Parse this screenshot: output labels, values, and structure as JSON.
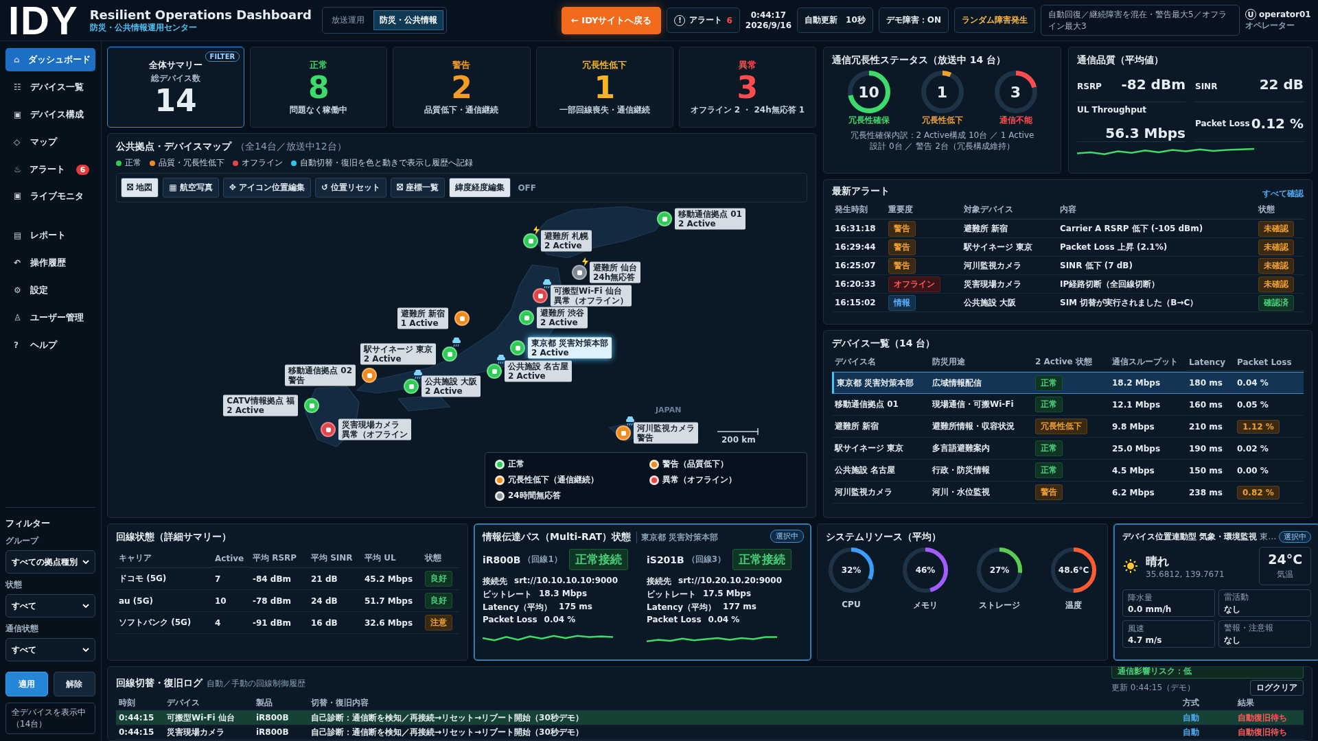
{
  "header": {
    "logo": "IDY",
    "title": "Resilient Operations Dashboard",
    "subtitle": "防災・公共情報運用センター",
    "modes": [
      {
        "label": "放送運用",
        "selected": false
      },
      {
        "label": "防災・公共情報",
        "selected": true
      }
    ],
    "back_button": "← IDYサイトへ戻る",
    "alert_button": {
      "icon": "!",
      "label": "アラート",
      "count": "6"
    },
    "time": "0:44:17",
    "date": "2026/9/16",
    "auto_refresh": "自動更新　10秒",
    "demo_fault": "デモ障害：ON",
    "random_fault": "ランダム障害発生",
    "notice": "自動回復／継続障害を混在・警告最大5／オフライン最大3",
    "user": {
      "icon": "U",
      "name": "operator01",
      "role": "オペレーター"
    }
  },
  "sidebar": {
    "items": [
      {
        "icon": "⌂",
        "label": "ダッシュボード",
        "selected": true
      },
      {
        "icon": "☷",
        "label": "デバイス一覧",
        "selected": false
      },
      {
        "icon": "▣",
        "label": "デバイス構成",
        "selected": false
      },
      {
        "icon": "◇",
        "label": "マップ",
        "selected": false
      },
      {
        "icon": "♨",
        "label": "アラート",
        "selected": false,
        "badge": "6"
      },
      {
        "icon": "▣",
        "label": "ライブモニタ",
        "selected": false
      },
      {
        "icon": "▤",
        "label": "レポート",
        "selected": false
      },
      {
        "icon": "↶",
        "label": "操作履歴",
        "selected": false
      },
      {
        "icon": "⚙",
        "label": "設定",
        "selected": false
      },
      {
        "icon": "♙",
        "label": "ユーザー管理",
        "selected": false
      },
      {
        "icon": "?",
        "label": "ヘルプ",
        "selected": false
      }
    ],
    "filters": {
      "title": "フィルター",
      "fields": [
        {
          "label": "グループ",
          "value": "すべての拠点種別"
        },
        {
          "label": "状態",
          "value": "すべて"
        },
        {
          "label": "通信状態",
          "value": "すべて"
        }
      ],
      "apply": "適用",
      "clear": "解除",
      "status": "全デバイスを表示中（14台）"
    }
  },
  "summary": {
    "cards": [
      {
        "kind": "total",
        "title": "全体サマリー",
        "subtitle": "総デバイス数",
        "value": "14",
        "badge": "FILTER"
      },
      {
        "kind": "status",
        "title": "正常",
        "value": "8",
        "note": "問題なく稼働中",
        "color": "#3ddc6a"
      },
      {
        "kind": "status",
        "title": "警告",
        "value": "2",
        "note": "品質低下・通信継続",
        "color": "#f59b23"
      },
      {
        "kind": "status",
        "title": "冗長性低下",
        "value": "1",
        "note": "一部回線喪失・通信継続",
        "color": "#f5b420"
      },
      {
        "kind": "status",
        "title": "異常",
        "value": "3",
        "note": "オフライン 2 ・ 24h無応答 1",
        "color": "#ff4d4f"
      }
    ]
  },
  "map": {
    "title": "公共拠点・デバイスマップ",
    "count": "（全14台／放送中12台）",
    "legend_line": [
      {
        "label": "正常",
        "color": "#2ecc55"
      },
      {
        "label": "品質・冗長性低下",
        "color": "#f08a1c"
      },
      {
        "label": "オフライン",
        "color": "#e84545"
      },
      {
        "label": "自動切替・復旧を色と動きで表示し履歴へ記録",
        "color": "#2cc6f0"
      }
    ],
    "tools": [
      {
        "icon": "⛝",
        "label": "地図",
        "selected": true
      },
      {
        "icon": "▦",
        "label": "航空写真",
        "selected": false
      },
      {
        "icon": "✥",
        "label": "アイコン位置編集",
        "selected": false
      },
      {
        "icon": "↺",
        "label": "位置リセット",
        "selected": false
      },
      {
        "icon": "⛝",
        "label": "座標一覧",
        "selected": false
      }
    ],
    "latlon_edit": {
      "label": "緯度経度編集",
      "state": "OFF"
    },
    "markers": [
      {
        "name": "移動通信拠点 01",
        "status": "2 Active",
        "kind": "normal",
        "selected": false
      },
      {
        "name": "避難所 札幌",
        "status": "2 Active",
        "kind": "normal",
        "selected": false,
        "weather": {
          "kind": "lightning"
        }
      },
      {
        "name": "避難所 仙台",
        "status": "24h無応答",
        "kind": "noresponse",
        "selected": false,
        "weather": {
          "kind": "lightning"
        }
      },
      {
        "name": "可搬型Wi-Fi 仙台",
        "status": "異常（オフライン）",
        "kind": "offline",
        "selected": false,
        "weather": {
          "kind": "rain"
        }
      },
      {
        "name": "避難所 新宿",
        "status": "1 Active",
        "kind": "warning",
        "selected": false
      },
      {
        "name": "避難所 渋谷",
        "status": "2 Active",
        "kind": "normal",
        "selected": false
      },
      {
        "name": "駅サイネージ 東京",
        "status": "2 Active",
        "kind": "normal",
        "selected": false,
        "weather": {
          "kind": "rain"
        }
      },
      {
        "name": "東京都 災害対策本部",
        "status": "2 Active",
        "kind": "normal",
        "selected": true
      },
      {
        "name": "移動通信拠点 02",
        "status": "警告",
        "kind": "warning",
        "selected": false
      },
      {
        "name": "公共施設 大阪",
        "status": "2 Active",
        "kind": "normal",
        "selected": false,
        "weather": {
          "kind": "rain"
        }
      },
      {
        "name": "公共施設 名古屋",
        "status": "2 Active",
        "kind": "normal",
        "selected": false,
        "weather": {
          "kind": "rain"
        }
      },
      {
        "name": "CATV情報拠点 福",
        "status": "2 Active",
        "kind": "normal",
        "selected": false
      },
      {
        "name": "災害現場カメラ",
        "status": "異常（オフライン",
        "kind": "offline",
        "selected": false
      },
      {
        "name": "河川監視カメラ",
        "status": "警告",
        "kind": "warning",
        "selected": false,
        "weather": {
          "kind": "rain"
        }
      }
    ],
    "region_label": "JAPAN",
    "scale": "200 km",
    "legend": [
      {
        "label": "正常",
        "color": "#2ecc55"
      },
      {
        "label": "警告（品質低下）",
        "color": "#f08a1c"
      },
      {
        "label": "冗長性低下（通信継続）",
        "color": "#f08a1c"
      },
      {
        "label": "異常（オフライン）",
        "color": "#e84545"
      },
      {
        "label": "24時間無応答",
        "color": "#8a95a0"
      }
    ]
  },
  "redundancy": {
    "title": "通信冗長性ステータス（放送中 14 台）",
    "gauges": [
      {
        "value": "10",
        "label": "冗長性確保",
        "level": 0.72,
        "color": "#3ddc6a"
      },
      {
        "value": "1",
        "label": "冗長性低下",
        "level": 0.07,
        "color": "#f0a030"
      },
      {
        "value": "3",
        "label": "通信不能",
        "level": 0.21,
        "color": "#ff4d4f"
      }
    ],
    "note": "冗長性確保内訳：2 Active構成 10台 ／ 1 Active設計 0台 ／ 警告 2台（冗長構成維持）"
  },
  "quality": {
    "title": "通信品質（平均値）",
    "metrics": [
      {
        "label": "RSRP",
        "value": "-82 dBm"
      },
      {
        "label": "SINR",
        "value": "22 dB"
      },
      {
        "label": "UL Throughput",
        "value": "56.3 Mbps"
      },
      {
        "label": "Packet Loss",
        "value": "0.12 %"
      }
    ]
  },
  "alerts": {
    "title": "最新アラート",
    "link": "すべて確認",
    "columns": [
      "発生時刻",
      "重要度",
      "対象デバイス",
      "内容",
      "状態"
    ],
    "rows": [
      {
        "time": "16:31:18",
        "severity": {
          "label": "警告",
          "kind": "warning"
        },
        "device": "避難所 新宿",
        "content": "Carrier A RSRP 低下 (-105 dBm)",
        "status": {
          "label": "未確認",
          "kind": "open"
        }
      },
      {
        "time": "16:29:44",
        "severity": {
          "label": "警告",
          "kind": "warning"
        },
        "device": "駅サイネージ 東京",
        "content": "Packet Loss 上昇 (2.1%)",
        "status": {
          "label": "未確認",
          "kind": "open"
        }
      },
      {
        "time": "16:25:07",
        "severity": {
          "label": "警告",
          "kind": "warning"
        },
        "device": "河川監視カメラ",
        "content": "SINR 低下 (7 dB)",
        "status": {
          "label": "未確認",
          "kind": "open"
        }
      },
      {
        "time": "16:20:33",
        "severity": {
          "label": "オフライン",
          "kind": "offline"
        },
        "device": "災害現場カメラ",
        "content": "IP経路切断（全回線切断）",
        "status": {
          "label": "未確認",
          "kind": "open"
        }
      },
      {
        "time": "16:15:02",
        "severity": {
          "label": "情報",
          "kind": "info"
        },
        "device": "公共施設 大阪",
        "content": "SIM 切替が実行されました（B→C）",
        "status": {
          "label": "確認済",
          "kind": "done"
        }
      }
    ]
  },
  "devices": {
    "title": "デバイス一覧（14 台）",
    "columns": [
      "デバイス名",
      "防災用途",
      "2 Active 状態",
      "通信スループット",
      "Latency",
      "Packet Loss"
    ],
    "rows": [
      {
        "name": "東京都 災害対策本部",
        "use": "広域情報配信",
        "state": {
          "label": "正常",
          "kind": "normal"
        },
        "throughput": "18.2 Mbps",
        "latency": "180 ms",
        "loss": {
          "label": "0.04 %",
          "kind": "normal"
        },
        "selected": true
      },
      {
        "name": "移動通信拠点 01",
        "use": "現場通信・可搬Wi-Fi",
        "state": {
          "label": "正常",
          "kind": "normal"
        },
        "throughput": "12.1 Mbps",
        "latency": "160 ms",
        "loss": {
          "label": "0.05 %",
          "kind": "normal"
        },
        "selected": false
      },
      {
        "name": "避難所 新宿",
        "use": "避難所情報・収容状況",
        "state": {
          "label": "冗長性低下",
          "kind": "warning"
        },
        "throughput": "9.8 Mbps",
        "latency": "210 ms",
        "loss": {
          "label": "1.12 %",
          "kind": "warning"
        },
        "selected": false
      },
      {
        "name": "駅サイネージ 東京",
        "use": "多言語避難案内",
        "state": {
          "label": "正常",
          "kind": "normal"
        },
        "throughput": "25.0 Mbps",
        "latency": "190 ms",
        "loss": {
          "label": "0.02 %",
          "kind": "normal"
        },
        "selected": false
      },
      {
        "name": "公共施設 名古屋",
        "use": "行政・防災情報",
        "state": {
          "label": "正常",
          "kind": "normal"
        },
        "throughput": "4.5 Mbps",
        "latency": "150 ms",
        "loss": {
          "label": "0.00 %",
          "kind": "normal"
        },
        "selected": false
      },
      {
        "name": "河川監視カメラ",
        "use": "河川・水位監視",
        "state": {
          "label": "警告",
          "kind": "warning"
        },
        "throughput": "6.2 Mbps",
        "latency": "238 ms",
        "loss": {
          "label": "0.82 %",
          "kind": "warning"
        },
        "selected": false
      }
    ]
  },
  "lines": {
    "title": "回線状態（詳細サマリー）",
    "columns": [
      "キャリア",
      "Active",
      "平均 RSRP",
      "平均 SINR",
      "平均 UL",
      "状態"
    ],
    "rows": [
      {
        "carrier": "ドコモ (5G)",
        "active": "7",
        "rsrp": "-84 dBm",
        "sinr": "21 dB",
        "ul": "45.2 Mbps",
        "status": {
          "label": "良好",
          "kind": "good"
        }
      },
      {
        "carrier": "au (5G)",
        "active": "10",
        "rsrp": "-78 dBm",
        "sinr": "24 dB",
        "ul": "51.7 Mbps",
        "status": {
          "label": "良好",
          "kind": "good"
        }
      },
      {
        "carrier": "ソフトバンク (5G)",
        "active": "4",
        "rsrp": "-91 dBm",
        "sinr": "16 dB",
        "ul": "32.6 Mbps",
        "status": {
          "label": "注意",
          "kind": "caution"
        }
      }
    ]
  },
  "multirat": {
    "title": "情報伝達パス（Multi-RAT）状態",
    "subtitle": "東京都 災害対策本部",
    "badge": "選択中",
    "paths": [
      {
        "name": "iR800B",
        "line": "（回線1）",
        "status": "正常接続",
        "fields": [
          {
            "label": "接続先",
            "value": "srt://10.10.10.10:9000"
          },
          {
            "label": "ビットレート",
            "value": "18.3 Mbps"
          },
          {
            "label": "Latency（平均）",
            "value": "175 ms"
          },
          {
            "label": "Packet Loss",
            "value": "0.04 %"
          }
        ]
      },
      {
        "name": "iS201B",
        "line": "（回線3）",
        "status": "正常接続",
        "fields": [
          {
            "label": "接続先",
            "value": "srt://10.20.10.20:9000"
          },
          {
            "label": "ビットレート",
            "value": "17.5 Mbps"
          },
          {
            "label": "Latency（平均）",
            "value": "177 ms"
          },
          {
            "label": "Packet Loss",
            "value": "0.04 %"
          }
        ]
      }
    ]
  },
  "resources": {
    "title": "システムリソース（平均）",
    "gauges": [
      {
        "value": "32%",
        "label": "CPU",
        "level": 0.32,
        "color": "#3aa0ff"
      },
      {
        "value": "46%",
        "label": "メモリ",
        "level": 0.46,
        "color": "#a25cff"
      },
      {
        "value": "27%",
        "label": "ストレージ",
        "level": 0.27,
        "color": "#5ccc50"
      },
      {
        "value": "48.6°C",
        "label": "温度",
        "level": 0.5,
        "color": "#ff5a30"
      }
    ]
  },
  "weather": {
    "title": "デバイス位置連動型 気象・環境監視",
    "tail": "東…",
    "badge": "選択中",
    "condition": "晴れ",
    "coords": "35.6812, 139.7671",
    "temperature": "24°C",
    "temperature_label": "気温",
    "cells": [
      {
        "label": "降水量",
        "value": "0.0 mm/h"
      },
      {
        "label": "雷活動",
        "value": "なし"
      },
      {
        "label": "風速",
        "value": "4.7 m/s"
      },
      {
        "label": "警報・注意報",
        "value": "なし"
      }
    ],
    "risk": "通信影響リスク：低"
  },
  "log": {
    "title": "回線切替・復旧ログ",
    "subtitle": "自動／手動の回線制御履歴",
    "updated": "更新 0:44:15（デモ）",
    "clear": "ログクリア",
    "columns": [
      "時刻",
      "デバイス",
      "製品",
      "切替・復旧内容",
      "方式",
      "結果"
    ],
    "rows": [
      {
        "time": "0:44:15",
        "device": "可搬型Wi-Fi 仙台",
        "product": "iR800B",
        "content": "自己診断：通信断を検知／再接続→リセット→リブート開始（30秒デモ）",
        "method": "自動",
        "result": "自動復旧待ち",
        "selected": true
      },
      {
        "time": "0:44:15",
        "device": "災害現場カメラ",
        "product": "iR800B",
        "content": "自己診断：通信断を検知／再接続→リセット→リブート開始（30秒デモ）",
        "method": "自動",
        "result": "自動復旧待ち",
        "selected": false
      }
    ]
  }
}
